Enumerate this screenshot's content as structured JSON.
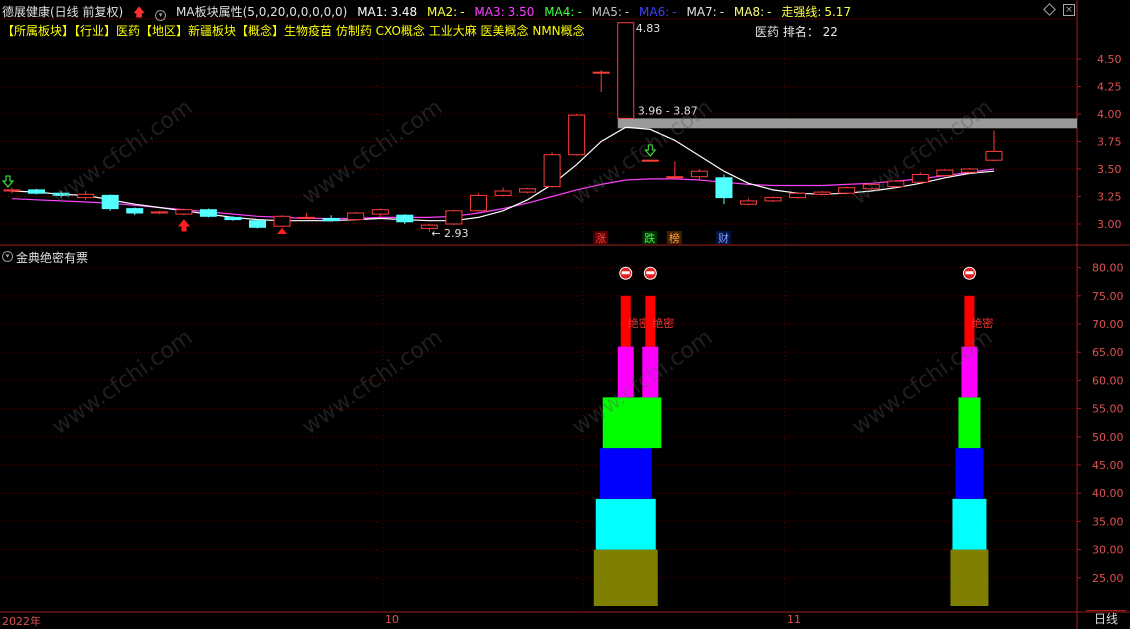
{
  "title_bar": {
    "stock": "德展健康(日线 前复权)",
    "indicator_name": "MA板块属性(5,0,20,0,0,0,0,0)",
    "ma1_label": "MA1:",
    "ma1_value": "3.48",
    "ma2_label": "MA2:",
    "ma2_value": "-",
    "ma3_label": "MA3:",
    "ma3_value": "3.50",
    "ma4_label": "MA4:",
    "ma4_value": "-",
    "ma5_label": "MA5:",
    "ma5_value": "-",
    "ma6_label": "MA6:",
    "ma6_value": "-",
    "ma7_label": "MA7:",
    "ma7_value": "-",
    "ma8_label": "MA8:",
    "ma8_value": "-",
    "trend_label": "走强线:",
    "trend_value": "5.17"
  },
  "concept_line": "【所属板块】【行业】医药【地区】新疆板块【概念】生物疫苗 仿制药 CXO概念 工业大麻 医美概念 NMN概念",
  "rank_text": "医药 排名： 22",
  "upper_axis_ticks": [
    "4.50",
    "4.25",
    "4.00",
    "3.75",
    "3.50",
    "3.25",
    "3.00"
  ],
  "lower_axis_ticks": [
    "80.00",
    "75.00",
    "70.00",
    "65.00",
    "60.00",
    "55.00",
    "50.00",
    "45.00",
    "40.00",
    "35.00",
    "30.00",
    "25.00"
  ],
  "annotations": {
    "high": "4.83",
    "low": "← 2.93",
    "range": "3.96 - 3.87"
  },
  "event_markers": [
    "涨",
    "跌",
    "榜",
    "财"
  ],
  "indicator_panel": {
    "title": "金典绝密有票",
    "signal_label": "绝密"
  },
  "time_axis": {
    "labels": [
      "2022年",
      "10",
      "11"
    ],
    "period": "日线"
  },
  "watermark": "www.cfchi.com",
  "colors": {
    "up": "#ff3c3c",
    "down": "#54ffff",
    "ma1": "#ffffff",
    "ma3": "#ff40ff",
    "grid": "#5a0000",
    "axis_text": "#e05050"
  },
  "chart_data": {
    "type": "candlestick",
    "ylim": [
      2.85,
      5.0
    ],
    "candles": [
      {
        "o": 3.3,
        "h": 3.33,
        "l": 3.28,
        "c": 3.31
      },
      {
        "o": 3.31,
        "h": 3.32,
        "l": 3.27,
        "c": 3.28
      },
      {
        "o": 3.28,
        "h": 3.3,
        "l": 3.24,
        "c": 3.26
      },
      {
        "o": 3.24,
        "h": 3.3,
        "l": 3.22,
        "c": 3.27
      },
      {
        "o": 3.26,
        "h": 3.27,
        "l": 3.12,
        "c": 3.14
      },
      {
        "o": 3.14,
        "h": 3.15,
        "l": 3.08,
        "c": 3.1
      },
      {
        "o": 3.1,
        "h": 3.12,
        "l": 3.09,
        "c": 3.11
      },
      {
        "o": 3.09,
        "h": 3.14,
        "l": 3.08,
        "c": 3.13
      },
      {
        "o": 3.13,
        "h": 3.14,
        "l": 3.06,
        "c": 3.07
      },
      {
        "o": 3.06,
        "h": 3.07,
        "l": 3.03,
        "c": 3.04
      },
      {
        "o": 3.03,
        "h": 3.04,
        "l": 2.96,
        "c": 2.97
      },
      {
        "o": 2.98,
        "h": 3.08,
        "l": 2.97,
        "c": 3.07
      },
      {
        "o": 3.06,
        "h": 3.1,
        "l": 3.05,
        "c": 3.06
      },
      {
        "o": 3.05,
        "h": 3.08,
        "l": 3.02,
        "c": 3.03
      },
      {
        "o": 3.04,
        "h": 3.11,
        "l": 3.03,
        "c": 3.1
      },
      {
        "o": 3.09,
        "h": 3.14,
        "l": 3.06,
        "c": 3.13
      },
      {
        "o": 3.08,
        "h": 3.09,
        "l": 3.0,
        "c": 3.02
      },
      {
        "o": 2.96,
        "h": 3.0,
        "l": 2.93,
        "c": 2.99
      },
      {
        "o": 3.0,
        "h": 3.13,
        "l": 2.99,
        "c": 3.12
      },
      {
        "o": 3.12,
        "h": 3.28,
        "l": 3.11,
        "c": 3.26
      },
      {
        "o": 3.26,
        "h": 3.33,
        "l": 3.25,
        "c": 3.3
      },
      {
        "o": 3.29,
        "h": 3.33,
        "l": 3.28,
        "c": 3.32
      },
      {
        "o": 3.34,
        "h": 3.65,
        "l": 3.33,
        "c": 3.63
      },
      {
        "o": 3.63,
        "h": 4.0,
        "l": 3.62,
        "c": 3.99
      },
      {
        "o": 4.38,
        "h": 4.4,
        "l": 4.2,
        "c": 4.38
      },
      {
        "o": 3.96,
        "h": 4.83,
        "l": 3.96,
        "c": 4.83
      },
      {
        "o": 3.58,
        "h": 3.58,
        "l": 3.58,
        "c": 3.58
      },
      {
        "o": 3.43,
        "h": 3.57,
        "l": 3.41,
        "c": 3.43
      },
      {
        "o": 3.43,
        "h": 3.5,
        "l": 3.4,
        "c": 3.48
      },
      {
        "o": 3.42,
        "h": 3.45,
        "l": 3.18,
        "c": 3.24
      },
      {
        "o": 3.18,
        "h": 3.23,
        "l": 3.17,
        "c": 3.21
      },
      {
        "o": 3.21,
        "h": 3.25,
        "l": 3.2,
        "c": 3.24
      },
      {
        "o": 3.24,
        "h": 3.29,
        "l": 3.23,
        "c": 3.28
      },
      {
        "o": 3.27,
        "h": 3.3,
        "l": 3.26,
        "c": 3.29
      },
      {
        "o": 3.28,
        "h": 3.34,
        "l": 3.27,
        "c": 3.33
      },
      {
        "o": 3.32,
        "h": 3.37,
        "l": 3.31,
        "c": 3.36
      },
      {
        "o": 3.34,
        "h": 3.4,
        "l": 3.33,
        "c": 3.39
      },
      {
        "o": 3.38,
        "h": 3.47,
        "l": 3.37,
        "c": 3.45
      },
      {
        "o": 3.44,
        "h": 3.5,
        "l": 3.43,
        "c": 3.49
      },
      {
        "o": 3.47,
        "h": 3.51,
        "l": 3.45,
        "c": 3.5
      },
      {
        "o": 3.58,
        "h": 3.85,
        "l": 3.57,
        "c": 3.66
      }
    ],
    "ma1": [
      3.3,
      3.29,
      3.27,
      3.26,
      3.22,
      3.18,
      3.15,
      3.12,
      3.09,
      3.06,
      3.04,
      3.03,
      3.03,
      3.03,
      3.04,
      3.05,
      3.04,
      3.03,
      3.03,
      3.06,
      3.12,
      3.22,
      3.36,
      3.54,
      3.75,
      3.88,
      3.86,
      3.76,
      3.62,
      3.48,
      3.37,
      3.31,
      3.28,
      3.27,
      3.28,
      3.3,
      3.33,
      3.37,
      3.42,
      3.46,
      3.48
    ],
    "ma3": [
      3.23,
      3.22,
      3.21,
      3.2,
      3.19,
      3.17,
      3.15,
      3.13,
      3.11,
      3.09,
      3.07,
      3.06,
      3.05,
      3.05,
      3.05,
      3.06,
      3.06,
      3.06,
      3.07,
      3.1,
      3.14,
      3.19,
      3.25,
      3.31,
      3.36,
      3.4,
      3.41,
      3.41,
      3.4,
      3.38,
      3.36,
      3.35,
      3.35,
      3.35,
      3.36,
      3.37,
      3.39,
      3.41,
      3.44,
      3.47,
      3.5
    ],
    "signal_bars": [
      {
        "index": 25,
        "top": 75
      },
      {
        "index": 26,
        "top": 75
      },
      {
        "index": 39,
        "top": 75
      }
    ],
    "signal_band_colors": [
      "#808000",
      "#00ffff",
      "#0000ff",
      "#00ff00",
      "#ff00ff",
      "#ff0000"
    ],
    "signal_bands": [
      [
        20,
        30
      ],
      [
        30,
        39
      ],
      [
        39,
        48
      ],
      [
        48,
        57
      ],
      [
        57,
        66
      ],
      [
        66,
        75
      ]
    ],
    "lower_ylim": [
      20,
      81
    ]
  }
}
